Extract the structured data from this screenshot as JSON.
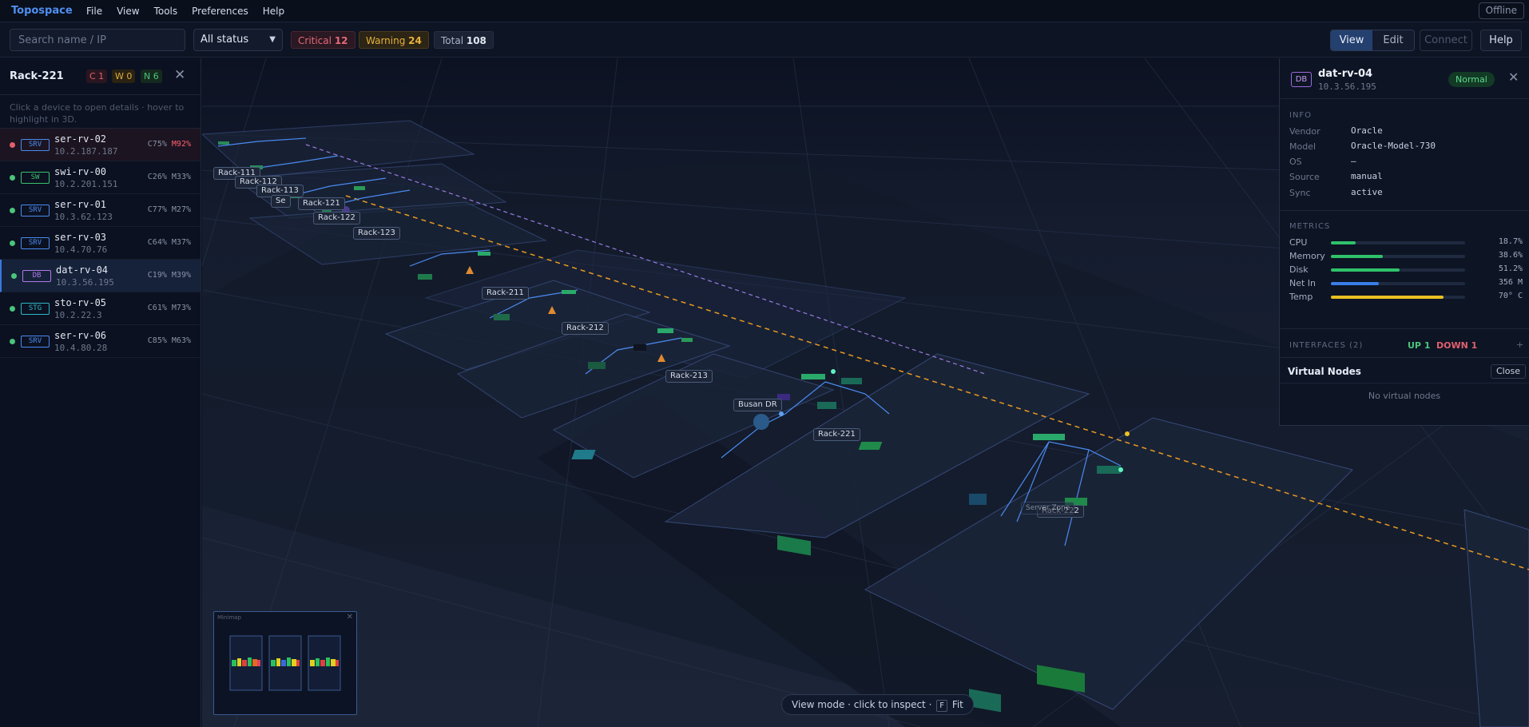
{
  "app": {
    "brand": "Topospace",
    "offline_label": "Offline"
  },
  "menu": [
    "File",
    "View",
    "Tools",
    "Preferences",
    "Help"
  ],
  "toolbar": {
    "search_placeholder": "Search name / IP",
    "status_filter": "All status",
    "critical_label": "Critical",
    "critical_count": "12",
    "warning_label": "Warning",
    "warning_count": "24",
    "total_label": "Total",
    "total_count": "108",
    "view_label": "View",
    "edit_label": "Edit",
    "connect_label": "Connect",
    "help_label": "Help"
  },
  "left_panel": {
    "title": "Rack-221",
    "badge_c": "C 1",
    "badge_w": "W 0",
    "badge_n": "N 6",
    "hint": "Click a device to open details · hover to highlight in 3D.",
    "devices": [
      {
        "type": "SRV",
        "name": "ser-rv-02",
        "ip": "10.2.187.187",
        "cpu": "C75%",
        "mem": "M92%",
        "status": "critical"
      },
      {
        "type": "SW",
        "name": "swi-rv-00",
        "ip": "10.2.201.151",
        "cpu": "C26%",
        "mem": "M33%",
        "status": "normal"
      },
      {
        "type": "SRV",
        "name": "ser-rv-01",
        "ip": "10.3.62.123",
        "cpu": "C77%",
        "mem": "M27%",
        "status": "normal"
      },
      {
        "type": "SRV",
        "name": "ser-rv-03",
        "ip": "10.4.70.76",
        "cpu": "C64%",
        "mem": "M37%",
        "status": "normal"
      },
      {
        "type": "DB",
        "name": "dat-rv-04",
        "ip": "10.3.56.195",
        "cpu": "C19%",
        "mem": "M39%",
        "status": "normal"
      },
      {
        "type": "STG",
        "name": "sto-rv-05",
        "ip": "10.2.22.3",
        "cpu": "C61%",
        "mem": "M73%",
        "status": "normal"
      },
      {
        "type": "SRV",
        "name": "ser-rv-06",
        "ip": "10.4.80.28",
        "cpu": "C85%",
        "mem": "M63%",
        "status": "normal"
      }
    ]
  },
  "canvas": {
    "rack_labels": [
      "Rack-111",
      "Rack-112",
      "Rack-113",
      "Se",
      "Rack-121",
      "Rack-122",
      "Rack-123",
      "Rack-211",
      "Rack-212",
      "Rack-213",
      "Busan DR",
      "Rack-221",
      "Rack-222",
      "Server Zone"
    ],
    "minimap_title": "Minimap",
    "mode_hint_pre": "View mode · click to inspect ·",
    "mode_hint_key": "F",
    "mode_hint_post": "Fit"
  },
  "detail": {
    "type": "DB",
    "name": "dat-rv-04",
    "ip": "10.3.56.195",
    "status": "Normal",
    "info_title": "INFO",
    "info": [
      {
        "k": "Vendor",
        "v": "Oracle"
      },
      {
        "k": "Model",
        "v": "Oracle-Model-730"
      },
      {
        "k": "OS",
        "v": "–"
      },
      {
        "k": "Source",
        "v": "manual"
      },
      {
        "k": "Sync",
        "v": "active"
      }
    ],
    "metrics_title": "METRICS",
    "metrics": [
      {
        "label": "CPU",
        "value": "18.7%",
        "fraction": 0.187,
        "color": "#2fc26a"
      },
      {
        "label": "Memory",
        "value": "38.6%",
        "fraction": 0.386,
        "color": "#2fc26a"
      },
      {
        "label": "Disk",
        "value": "51.2%",
        "fraction": 0.512,
        "color": "#2fc26a"
      },
      {
        "label": "Net In",
        "value": "356 M",
        "fraction": 0.356,
        "color": "#3a7ee8"
      },
      {
        "label": "Temp",
        "value": "70° C",
        "fraction": 0.84,
        "color": "#e8c020"
      }
    ],
    "interfaces_title": "INTERFACES (2)",
    "if_up": "UP 1",
    "if_down": "DOWN 1",
    "if_plus": "+",
    "vn_title": "Virtual Nodes",
    "vn_close": "Close",
    "vn_empty": "No virtual nodes"
  },
  "colors": {
    "accent": "#4f8ff0",
    "critical": "#e0606e",
    "warning": "#e6b23c",
    "normal": "#4cc47a"
  }
}
